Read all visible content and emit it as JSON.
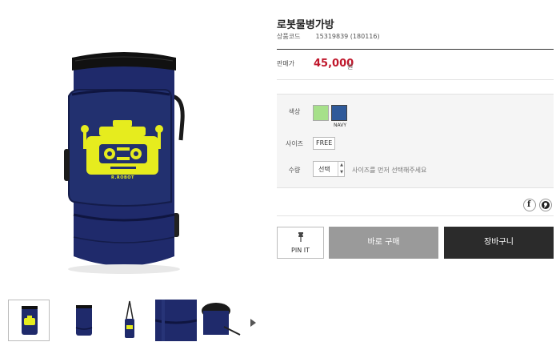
{
  "product": {
    "title": "로봇물병가방",
    "code_label": "상품코드",
    "code_value": "15319839 (180116)",
    "price_label": "판매가",
    "price": "45,000",
    "currency": "원",
    "bag_print": "R.ROBOT"
  },
  "options": {
    "color_label": "색상",
    "colors": [
      {
        "name": "green",
        "hex": "#a6e08a",
        "caption": ""
      },
      {
        "name": "navy",
        "hex": "#2f5a9a",
        "caption": "NAVY"
      }
    ],
    "size_label": "사이즈",
    "size_value": "FREE",
    "qty_label": "수량",
    "qty_value": "선택",
    "qty_hint": "사이즈를 먼저 선택해주세요"
  },
  "share": {
    "facebook_icon": "facebook-icon",
    "kakaostory_icon": "kakaostory-icon"
  },
  "actions": {
    "pin_label": "PIN IT",
    "buy_now_label": "바로 구매",
    "cart_label": "장바구니"
  },
  "gallery": {
    "thumbnails": [
      "front",
      "front-plain",
      "with-strap",
      "detail-zipper",
      "detail-open"
    ],
    "next_icon": "chevron-right-icon"
  },
  "colors": {
    "bag_navy": "#1f2a6b",
    "robot_yellow": "#e6ec1e",
    "price_red": "#c0172c",
    "buy_button": "#9a9a9a",
    "cart_button": "#2b2b2b"
  }
}
